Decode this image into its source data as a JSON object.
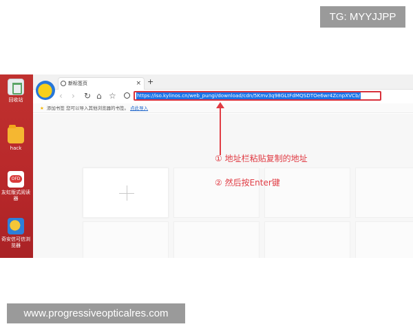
{
  "watermark_tg": "TG: MYYJJPP",
  "site_watermark": "www.progressiveopticalres.com",
  "desktop": {
    "icons": [
      {
        "label": "回收站",
        "icon": "trash-icon"
      },
      {
        "label": "hack",
        "icon": "folder-icon"
      },
      {
        "label": "友虹版式阅读器",
        "icon": "ofd-reader-icon"
      },
      {
        "label": "奇安信可信浏览器",
        "icon": "browser-app-icon"
      }
    ]
  },
  "browser": {
    "tab_title": "新标签页",
    "tab_close": "×",
    "new_tab": "+",
    "url": "https://iso.kylinos.cn/web_pungi/download/cdn/5Kmv3q98GLtFdMQSDTOe6wr4ZcnpXVCb/",
    "bookmarks_text": "添加书签  您可以导入其他浏览器的书签。",
    "bookmarks_link": "点此导入"
  },
  "annotations": {
    "step1": "① 地址栏粘贴复制的地址",
    "step2": "② 然后按Enter键"
  },
  "colors": {
    "annotation": "#e03b43",
    "desktop": "#c0312f"
  }
}
